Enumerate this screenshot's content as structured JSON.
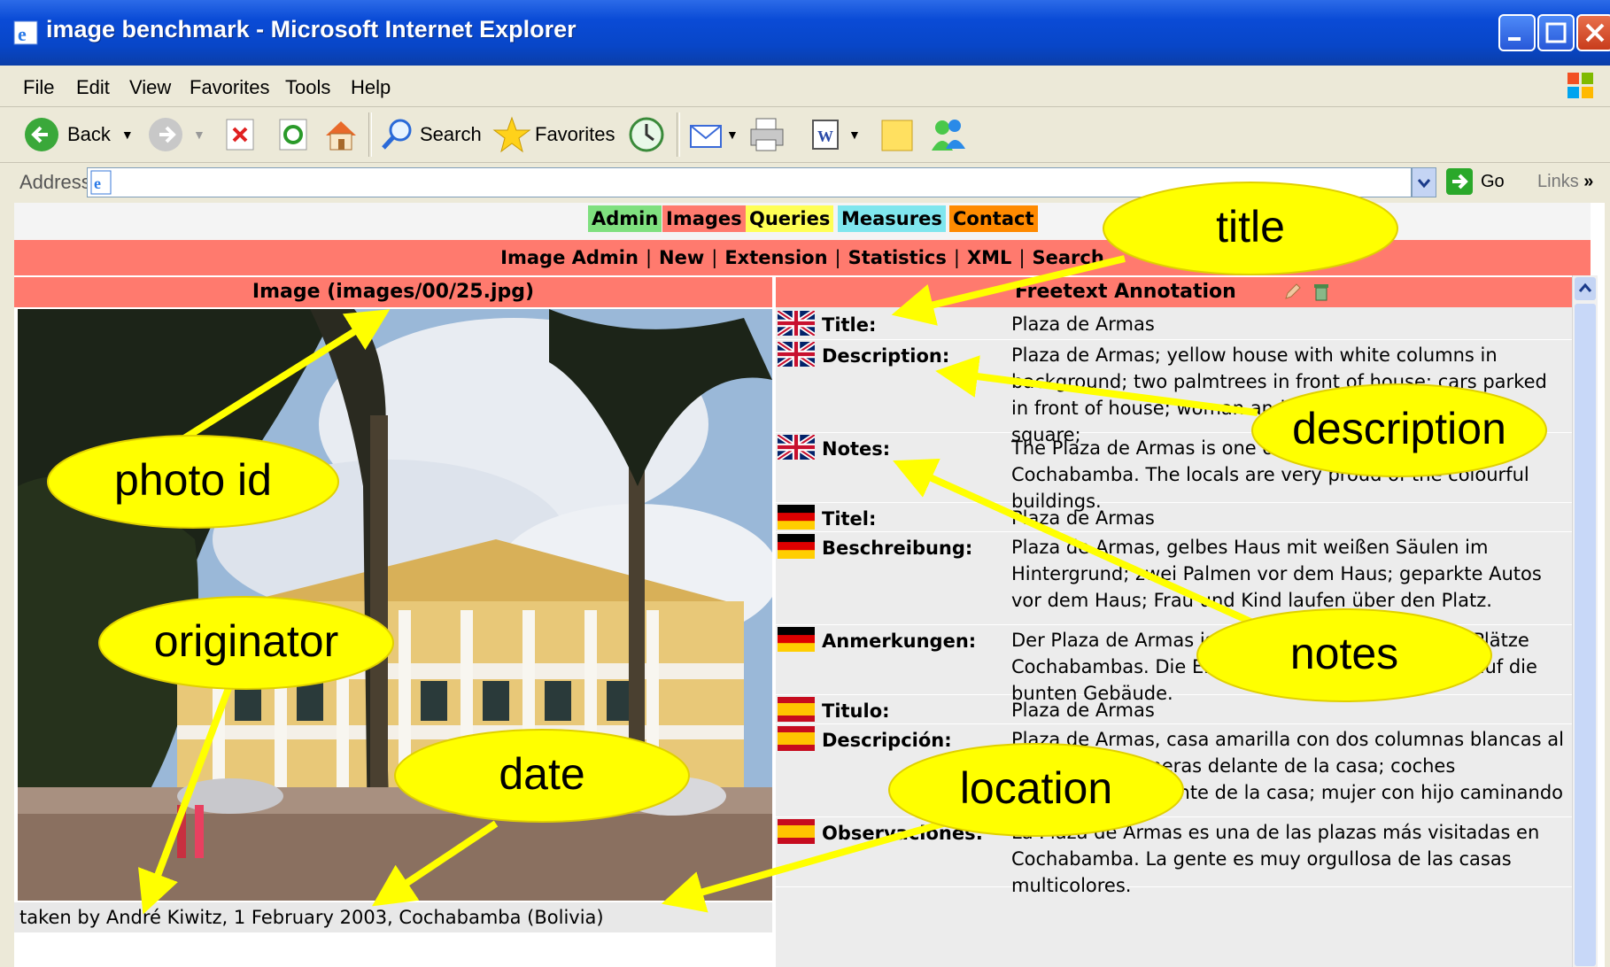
{
  "window": {
    "title": "image benchmark - Microsoft Internet Explorer"
  },
  "menu": [
    "File",
    "Edit",
    "View",
    "Favorites",
    "Tools",
    "Help"
  ],
  "toolbar": {
    "back": "Back",
    "search": "Search",
    "favorites": "Favorites"
  },
  "address": {
    "label": "Address",
    "value": "",
    "go": "Go",
    "links": "Links"
  },
  "topnav": [
    "Admin",
    "Images",
    "Queries",
    "Measures",
    "Contact"
  ],
  "topnav_colors": [
    "#7fe07f",
    "#ff7a6e",
    "#ffff55",
    "#7fe6ee",
    "#ff8a00"
  ],
  "subnav": [
    "Image Admin",
    "New",
    "Extension",
    "Statistics",
    "XML",
    "Search"
  ],
  "image_panel": {
    "header": "Image (images/00/25.jpg)",
    "caption": "taken by André Kiwitz, 1 February 2003, Cochabamba (Bolivia)"
  },
  "annotation": {
    "header": "Freetext Annotation",
    "rows": [
      {
        "flag": "uk",
        "label": "Title:",
        "value": "Plaza de Armas"
      },
      {
        "flag": "uk",
        "label": "Description:",
        "value": "Plaza de Armas; yellow house with white columns in background; two palmtrees in front of house; cars parked in front of house; woman and child walking over the square;"
      },
      {
        "flag": "uk",
        "label": "Notes:",
        "value": "The Plaza de Armas is one of the most visited places in Cochabamba. The locals are very proud of the colourful buildings."
      },
      {
        "flag": "de",
        "label": "Titel:",
        "value": "Plaza de Armas"
      },
      {
        "flag": "de",
        "label": "Beschreibung:",
        "value": "Plaza de Armas, gelbes Haus mit weißen Säulen im Hintergrund; zwei Palmen vor dem Haus; geparkte Autos vor dem Haus; Frau und Kind laufen über den Platz."
      },
      {
        "flag": "de",
        "label": "Anmerkungen:",
        "value": "Der Plaza de Armas ist einer der meistbesuchten Plätze Cochabambas. Die Einheimischen sind sehr stolz auf die bunten Gebäude."
      },
      {
        "flag": "es",
        "label": "Titulo:",
        "value": "Plaza de Armas"
      },
      {
        "flag": "es",
        "label": "Descripción:",
        "value": "Plaza de Armas, casa amarilla con dos columnas blancas al fondo; dos palmeras delante de la casa; coches aparqueados delante de la casa; mujer con hijo caminando por la plaza."
      },
      {
        "flag": "es",
        "label": "Observaciones:",
        "value": "La Plaza de Armas es una de las plazas más visitadas en Cochabamba. La gente es muy orgullosa de las casas multicolores."
      }
    ]
  },
  "callouts": {
    "title": "title",
    "description": "description",
    "notes": "notes",
    "photo_id": "photo id",
    "originator": "originator",
    "date": "date",
    "location": "location"
  }
}
